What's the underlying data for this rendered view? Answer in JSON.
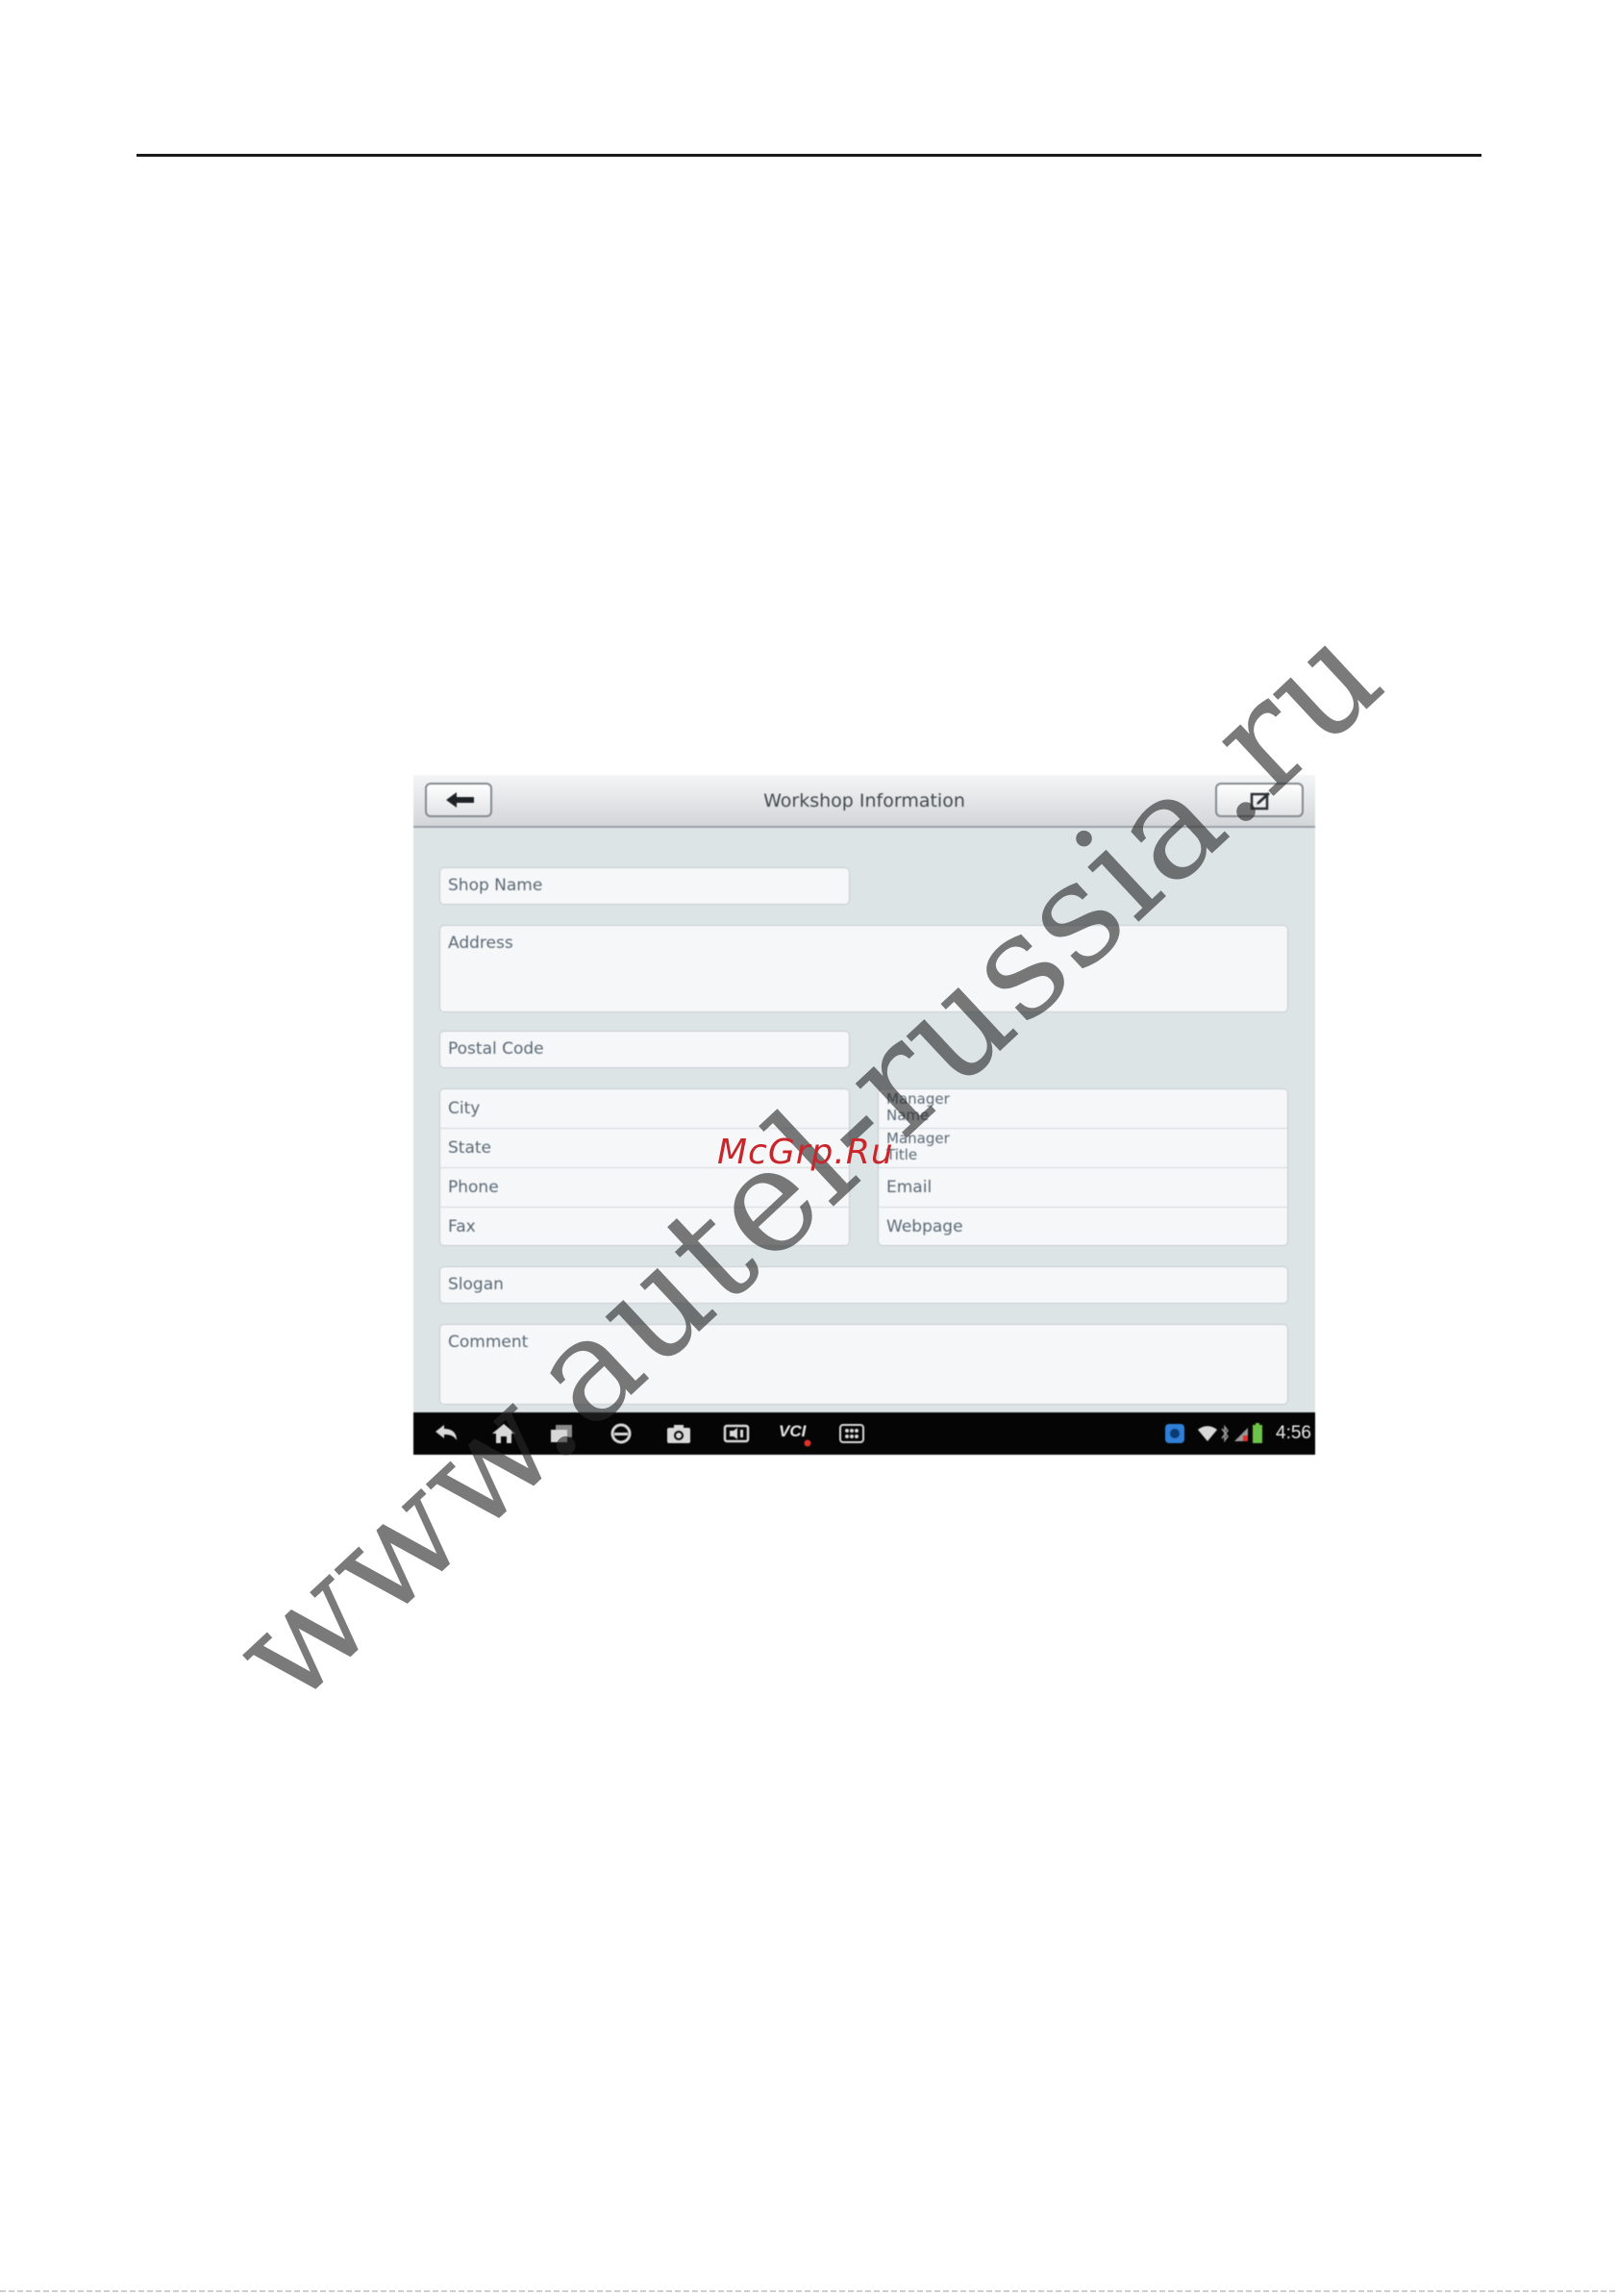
{
  "screen": {
    "title": "Workshop Information",
    "fields": {
      "shop_name": "Shop Name",
      "address": "Address",
      "postal_code": "Postal Code",
      "city": "City",
      "state": "State",
      "phone": "Phone",
      "fax": "Fax",
      "manager_name": "Manager Name",
      "manager_title": "Manager Title",
      "email": "Email",
      "webpage": "Webpage",
      "slogan": "Slogan",
      "comment": "Comment"
    },
    "navbar": {
      "vci_label": "VCI",
      "clock": "4:56"
    }
  },
  "watermarks": {
    "main": "www.autel-russia.ru",
    "secondary": "McGrp.Ru"
  },
  "colors": {
    "screen_background": "#dde4e6",
    "field_background": "#f6f7f8",
    "navbar_background": "#050505",
    "watermark_secondary": "#c8262b"
  }
}
